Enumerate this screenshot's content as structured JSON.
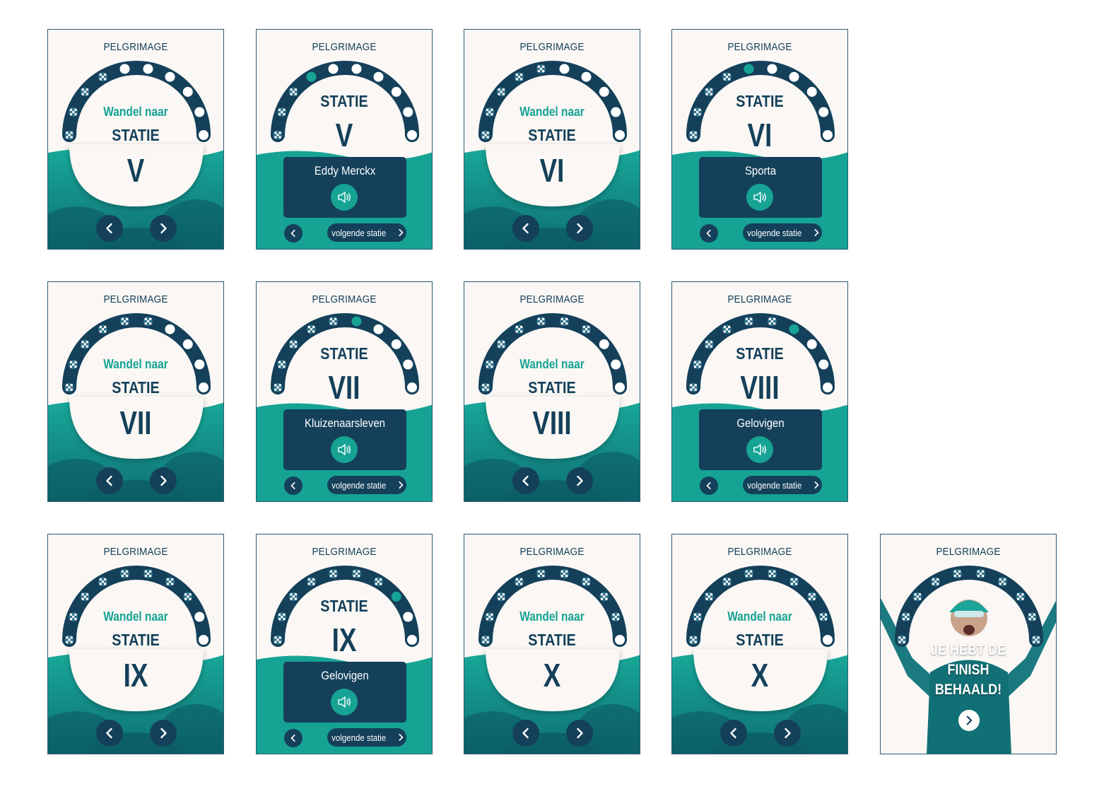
{
  "brand": "PELGRIMAGE",
  "walk_label": "Wandel naar",
  "statie_label": "STATIE",
  "next_label": "volgende statie",
  "finish_text": [
    "JE HEBT DE",
    "FINISH",
    "BEHAALD!"
  ],
  "colors": {
    "navy": "#14405a",
    "teal": "#16a394",
    "cream": "#faf7f4",
    "white": "#ffffff"
  },
  "icons": {
    "prev": "chevron-left-icon",
    "next": "chevron-right-icon",
    "audio": "speaker-icon",
    "done": "checkered-flag-icon"
  },
  "cards": [
    {
      "id": "c1",
      "type": "walk",
      "numeral": "V",
      "done": 4,
      "current": -1
    },
    {
      "id": "c2",
      "type": "station",
      "numeral": "V",
      "title": "Eddy Merckx",
      "done": 3,
      "current": 3
    },
    {
      "id": "c3",
      "type": "walk",
      "numeral": "VI",
      "done": 5,
      "current": -1
    },
    {
      "id": "c4",
      "type": "station",
      "numeral": "VI",
      "title": "Sporta",
      "done": 4,
      "current": 4
    },
    {
      "id": "c5",
      "type": "walk",
      "numeral": "VII",
      "done": 6,
      "current": -1
    },
    {
      "id": "c6",
      "type": "station",
      "numeral": "VII",
      "title": "Kluizenaarsleven",
      "done": 5,
      "current": 5
    },
    {
      "id": "c7",
      "type": "walk",
      "numeral": "VIII",
      "done": 7,
      "current": -1
    },
    {
      "id": "c8",
      "type": "station",
      "numeral": "VIII",
      "title": "Gelovigen",
      "done": 6,
      "current": 6
    },
    {
      "id": "c9",
      "type": "walk",
      "numeral": "IX",
      "done": 8,
      "current": -1
    },
    {
      "id": "c10",
      "type": "station",
      "numeral": "IX",
      "title": "Gelovigen",
      "done": 7,
      "current": 7
    },
    {
      "id": "c11",
      "type": "walk",
      "numeral": "X",
      "done": 9,
      "current": -1
    },
    {
      "id": "c12",
      "type": "walk",
      "numeral": "X",
      "done": 9,
      "current": -1
    },
    {
      "id": "c13",
      "type": "finish",
      "done": 10,
      "current": -1
    }
  ]
}
